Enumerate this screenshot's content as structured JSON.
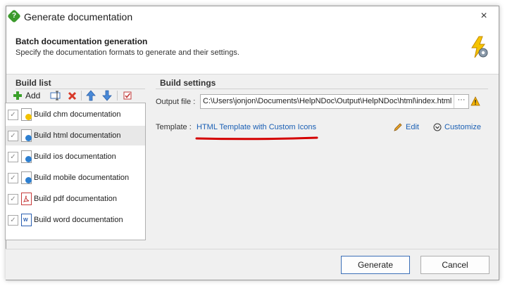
{
  "window": {
    "title": "Generate documentation",
    "close_icon": "×"
  },
  "header": {
    "title": "Batch documentation generation",
    "description": "Specify the documentation formats to generate and their settings."
  },
  "build_list": {
    "title": "Build list",
    "add_label": "Add",
    "items": [
      {
        "label": "Build chm documentation",
        "icon": "chm-file-icon",
        "checked": true
      },
      {
        "label": "Build html documentation",
        "icon": "html-file-icon",
        "checked": true,
        "selected": true
      },
      {
        "label": "Build ios documentation",
        "icon": "ios-file-icon",
        "checked": true
      },
      {
        "label": "Build mobile documentation",
        "icon": "mobile-file-icon",
        "checked": true
      },
      {
        "label": "Build pdf documentation",
        "icon": "pdf-file-icon",
        "checked": true
      },
      {
        "label": "Build word documentation",
        "icon": "word-file-icon",
        "checked": true
      }
    ]
  },
  "build_settings": {
    "title": "Build settings",
    "output_label": "Output file :",
    "output_value": "C:\\Users\\jonjon\\Documents\\HelpNDoc\\Output\\HelpNDoc\\html\\index.html",
    "browse_label": "···",
    "template_label": "Template :",
    "template_value": "HTML Template with Custom Icons",
    "edit_label": "Edit",
    "customize_label": "Customize"
  },
  "footer": {
    "generate_label": "Generate",
    "cancel_label": "Cancel"
  },
  "colors": {
    "link": "#1a5fb4",
    "highlight_mark": "#d40000",
    "warning": "#f5b400"
  }
}
